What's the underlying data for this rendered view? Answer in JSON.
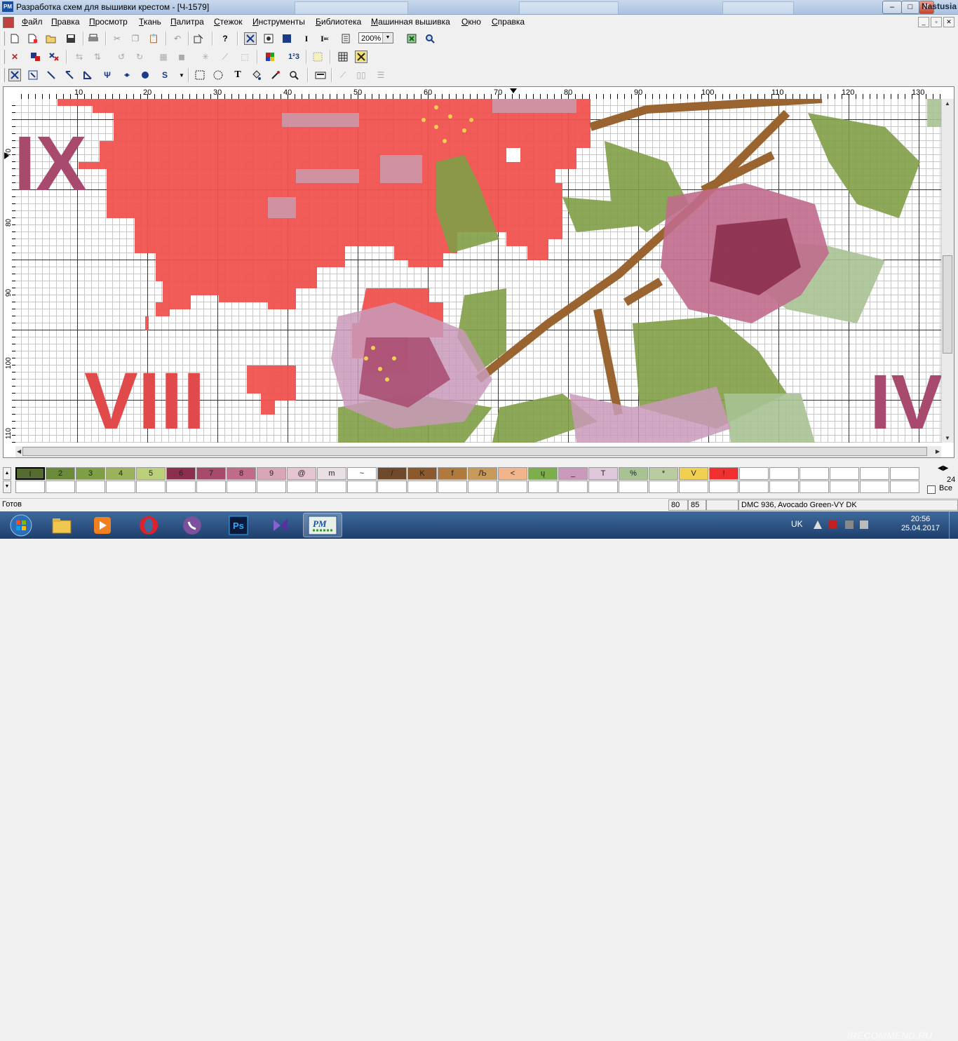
{
  "window": {
    "title": "Разработка схем для вышивки крестом - [Ч-1579]",
    "app_icon": "PM",
    "user": "Nastusia",
    "buttons": {
      "minimize": "–",
      "maximize": "□",
      "close": "✕"
    }
  },
  "menu": [
    "Файл",
    "Правка",
    "Просмотр",
    "Ткань",
    "Палитра",
    "Стежок",
    "Инструменты",
    "Библиотека",
    "Машинная вышивка",
    "Окно",
    "Справка"
  ],
  "mdi_buttons": {
    "minimize": "_",
    "restore": "▫",
    "close": "✕"
  },
  "toolbar1": {
    "zoom": "200%"
  },
  "ruler": {
    "h_labels": [
      "10",
      "20",
      "30",
      "40",
      "50",
      "60",
      "70",
      "80",
      "90",
      "100",
      "110",
      "120",
      "130"
    ],
    "v_labels": [
      "70",
      "80",
      "90",
      "100",
      "110"
    ]
  },
  "canvas_text": {
    "roman_left_top": "IX",
    "roman_left_bottom": "VIII",
    "roman_right": "IV"
  },
  "palette": {
    "count": "24",
    "all_label": "Все",
    "swatches": [
      {
        "sym": "",
        "color": "#556b2f"
      },
      {
        "sym": "2",
        "color": "#6b8a3a"
      },
      {
        "sym": "3",
        "color": "#7f9e46"
      },
      {
        "sym": "4",
        "color": "#9ab25a"
      },
      {
        "sym": "5",
        "color": "#bcd07c"
      },
      {
        "sym": "6",
        "color": "#8c2f4f"
      },
      {
        "sym": "7",
        "color": "#a84a6e"
      },
      {
        "sym": "8",
        "color": "#c06b8c"
      },
      {
        "sym": "9",
        "color": "#d9a6b8"
      },
      {
        "sym": "@",
        "color": "#e6c5d2"
      },
      {
        "sym": "m",
        "color": "#e9e0e6"
      },
      {
        "sym": "~",
        "color": "#ffffff"
      },
      {
        "sym": "/",
        "color": "#6e4a2a"
      },
      {
        "sym": "K",
        "color": "#8a5a2e"
      },
      {
        "sym": "f",
        "color": "#b07a3e"
      },
      {
        "sym": "Љ",
        "color": "#c89a5a"
      },
      {
        "sym": "<",
        "color": "#f2b48a"
      },
      {
        "sym": "ų",
        "color": "#7cae4c"
      },
      {
        "sym": "_",
        "color": "#c99aba"
      },
      {
        "sym": "T",
        "color": "#e0c8dc"
      },
      {
        "sym": "%",
        "color": "#a8c294"
      },
      {
        "sym": "*",
        "color": "#b8cca0"
      },
      {
        "sym": "V",
        "color": "#f0d050"
      },
      {
        "sym": "!",
        "color": "#f03030"
      }
    ]
  },
  "status": {
    "ready": "Готов",
    "x": "80",
    "y": "85",
    "color_name": "DMC  936, Avocado Green-VY DK"
  },
  "taskbar": {
    "lang": "UK",
    "time": "20:56",
    "date": "25.04.2017",
    "watermark": "iRECOMMEND.RU",
    "apps": [
      "start-orb",
      "explorer",
      "media-player",
      "opera",
      "viber",
      "photoshop",
      "visual-studio",
      "pattern-maker"
    ]
  },
  "icons": {
    "new": "new-file-icon",
    "open": "open-folder-icon",
    "save": "save-icon",
    "print": "print-icon"
  }
}
